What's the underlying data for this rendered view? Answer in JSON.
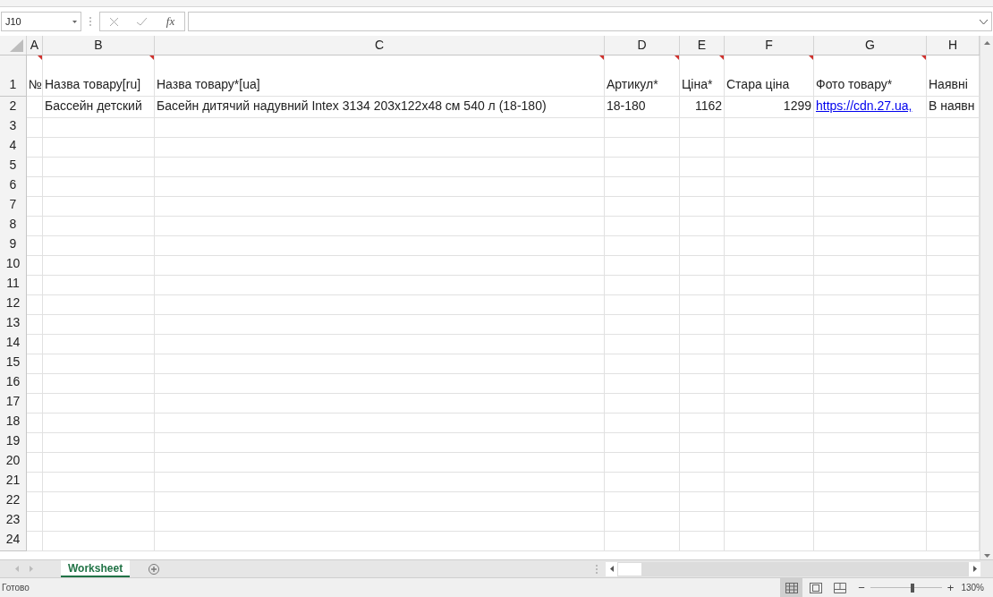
{
  "formula_bar": {
    "name_box": "J10",
    "function_label": "fx"
  },
  "columns": [
    "A",
    "B",
    "C",
    "D",
    "E",
    "F",
    "G",
    "H"
  ],
  "rows": [
    {
      "number": "1",
      "cells": [
        {
          "text": "№",
          "kind": "text",
          "has_comment": true
        },
        {
          "text": "Назва товару[ru]",
          "kind": "text",
          "has_comment": true
        },
        {
          "text": "Назва товару*[ua]",
          "kind": "text",
          "has_comment": true
        },
        {
          "text": "Артикул*",
          "kind": "text",
          "has_comment": true
        },
        {
          "text": "Ціна*",
          "kind": "text",
          "has_comment": true
        },
        {
          "text": "Стара ціна",
          "kind": "text",
          "has_comment": true
        },
        {
          "text": "Фото товару*",
          "kind": "text",
          "has_comment": true
        },
        {
          "text": "Наявні",
          "kind": "text"
        }
      ]
    },
    {
      "number": "2",
      "cells": [
        null,
        {
          "text": "Бассейн детский",
          "kind": "text"
        },
        {
          "text": "Басейн дитячий надувний Intex 3134 203x122x48 см 540 л (18-180)",
          "kind": "text"
        },
        {
          "text": "18-180",
          "kind": "text"
        },
        {
          "text": "1162",
          "kind": "number"
        },
        {
          "text": "1299",
          "kind": "number"
        },
        {
          "text": "https://cdn.27.ua,",
          "kind": "link"
        },
        {
          "text": "В наявн",
          "kind": "text"
        }
      ]
    },
    {
      "number": "3"
    },
    {
      "number": "4"
    },
    {
      "number": "5"
    },
    {
      "number": "6"
    },
    {
      "number": "7"
    },
    {
      "number": "8"
    },
    {
      "number": "9"
    },
    {
      "number": "10"
    },
    {
      "number": "11"
    },
    {
      "number": "12"
    },
    {
      "number": "13"
    },
    {
      "number": "14"
    },
    {
      "number": "15"
    },
    {
      "number": "16"
    },
    {
      "number": "17"
    },
    {
      "number": "18"
    },
    {
      "number": "19"
    },
    {
      "number": "20"
    },
    {
      "number": "21"
    },
    {
      "number": "22"
    },
    {
      "number": "23"
    },
    {
      "number": "24"
    }
  ],
  "sheet_tabs": [
    {
      "label": "Worksheet",
      "selected": true
    }
  ],
  "status_bar": {
    "status": "Готово",
    "views": [
      {
        "kind": "normal",
        "selected": true
      },
      {
        "kind": "page_layout",
        "selected": false
      },
      {
        "kind": "page_break",
        "selected": false
      }
    ],
    "zoom_out": "−",
    "zoom_in": "+",
    "zoom": "130%",
    "zoom_slider": {
      "level": 0.6
    }
  }
}
